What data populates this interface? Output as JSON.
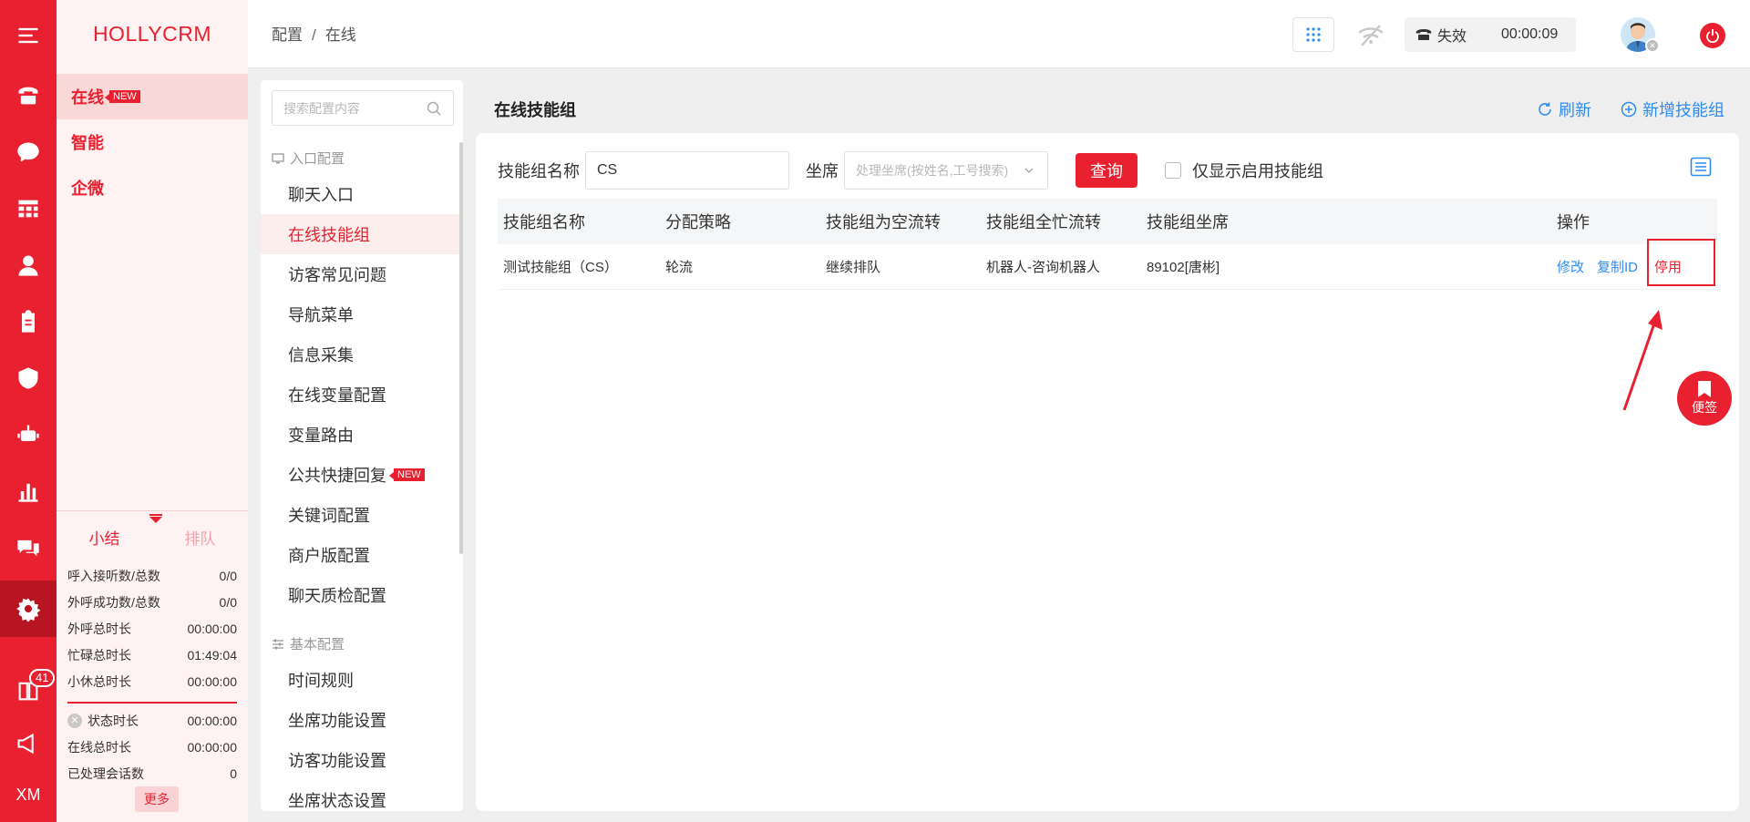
{
  "app": {
    "logo": "HOLLYCRM"
  },
  "rail": {
    "badge": "41",
    "bottom_label": "XM"
  },
  "nav2": {
    "items": [
      {
        "label": "在线",
        "tag": "NEW"
      },
      {
        "label": "智能"
      },
      {
        "label": "企微"
      }
    ]
  },
  "stats": {
    "tabs": [
      "小结",
      "排队"
    ],
    "rows": [
      {
        "label": "呼入接听数/总数",
        "value": "0/0"
      },
      {
        "label": "外呼成功数/总数",
        "value": "0/0"
      },
      {
        "label": "外呼总时长",
        "value": "00:00:00"
      },
      {
        "label": "忙碌总时长",
        "value": "01:49:04"
      },
      {
        "label": "小休总时长",
        "value": "00:00:00"
      }
    ],
    "rows2": [
      {
        "label": "状态时长",
        "value": "00:00:00"
      },
      {
        "label": "在线总时长",
        "value": "00:00:00"
      },
      {
        "label": "已处理会话数",
        "value": "0"
      }
    ],
    "more": "更多"
  },
  "header": {
    "breadcrumb": [
      "配置",
      "在线"
    ],
    "call_status": "失效",
    "call_time": "00:00:09"
  },
  "config_menu": {
    "search_placeholder": "搜索配置内容",
    "group1": "入口配置",
    "items1": [
      "聊天入口",
      "在线技能组",
      "访客常见问题",
      "导航菜单",
      "信息采集",
      "在线变量配置",
      "变量路由",
      "公共快捷回复",
      "关键词配置",
      "商户版配置",
      "聊天质检配置"
    ],
    "new_tag": "NEW",
    "group2": "基本配置",
    "items2": [
      "时间规则",
      "坐席功能设置",
      "访客功能设置",
      "坐席状态设置"
    ]
  },
  "main": {
    "title": "在线技能组",
    "refresh": "刷新",
    "add": "新增技能组",
    "filter": {
      "name_label": "技能组名称",
      "name_value": "CS",
      "seat_label": "坐席",
      "seat_placeholder": "处理坐席(按姓名,工号搜索)",
      "query": "查询",
      "only_enabled": "仅显示启用技能组"
    },
    "table": {
      "headers": [
        "技能组名称",
        "分配策略",
        "技能组为空流转",
        "技能组全忙流转",
        "技能组坐席",
        "操作"
      ],
      "rows": [
        {
          "name": "测试技能组（CS）",
          "strategy": "轮流",
          "empty": "继续排队",
          "busy": "机器人-咨询机器人",
          "seats": "89102[唐彬]",
          "ops": [
            "修改",
            "复制ID",
            "停用"
          ]
        }
      ]
    }
  },
  "sticky": {
    "label": "便签"
  },
  "colors": {
    "brand": "#e8202f",
    "link": "#2d8cf0"
  }
}
